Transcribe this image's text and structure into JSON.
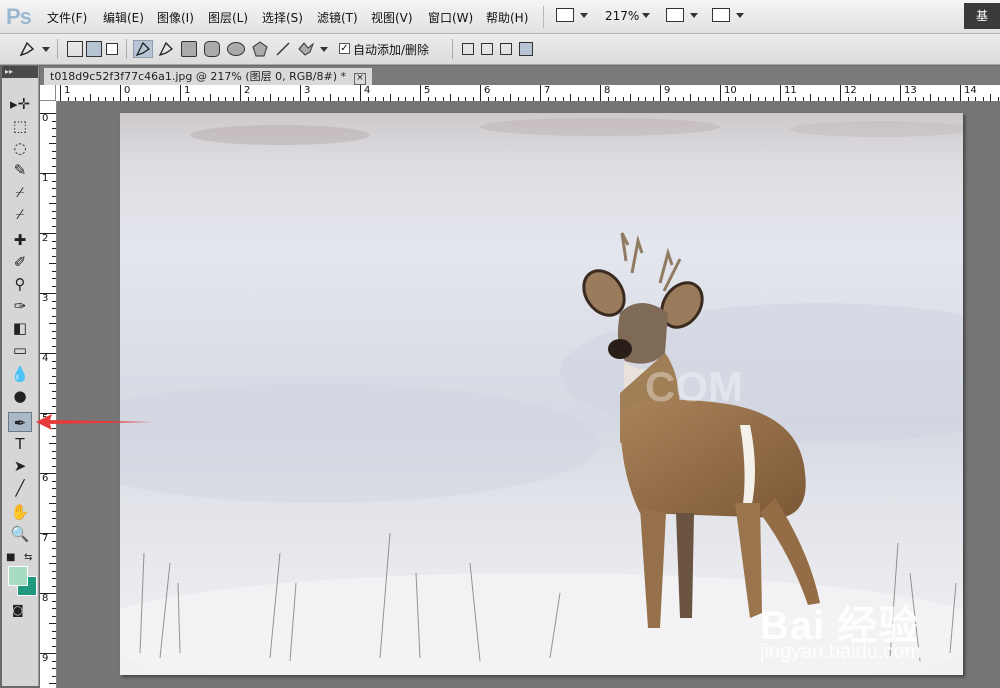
{
  "app": {
    "logo": "Ps"
  },
  "menu": [
    {
      "label": "文件(F)"
    },
    {
      "label": "编辑(E)"
    },
    {
      "label": "图像(I)"
    },
    {
      "label": "图层(L)"
    },
    {
      "label": "选择(S)"
    },
    {
      "label": "滤镜(T)"
    },
    {
      "label": "视图(V)"
    },
    {
      "label": "窗口(W)"
    },
    {
      "label": "帮助(H)"
    }
  ],
  "menubar": {
    "zoom": "217%",
    "workspace_label": "基"
  },
  "options": {
    "auto_add_delete_label": "自动添加/删除",
    "auto_add_delete_checked": true
  },
  "document": {
    "tab_title": "t018d9c52f3f77c46a1.jpg @ 217% (图层 0, RGB/8#) *",
    "close": "×"
  },
  "rulers": {
    "h": [
      "1",
      "0",
      "1",
      "2",
      "3",
      "4",
      "5",
      "6",
      "7",
      "8",
      "9",
      "10",
      "11",
      "12",
      "13",
      "14"
    ],
    "v": [
      "0",
      "1",
      "2",
      "3",
      "4",
      "5",
      "6",
      "7",
      "8",
      "9"
    ]
  },
  "tools": [
    {
      "name": "move-tool",
      "glyph": "▸✛"
    },
    {
      "name": "marquee-tool",
      "glyph": "⬚"
    },
    {
      "name": "lasso-tool",
      "glyph": "◌"
    },
    {
      "name": "quick-select-tool",
      "glyph": "✎"
    },
    {
      "name": "crop-tool",
      "glyph": "⌿"
    },
    {
      "name": "eyedropper-tool",
      "glyph": "⌿"
    },
    {
      "name": "healing-brush-tool",
      "glyph": "✚"
    },
    {
      "name": "brush-tool",
      "glyph": "✐"
    },
    {
      "name": "clone-stamp-tool",
      "glyph": "⚲"
    },
    {
      "name": "history-brush-tool",
      "glyph": "✑"
    },
    {
      "name": "eraser-tool",
      "glyph": "◧"
    },
    {
      "name": "gradient-tool",
      "glyph": "▭"
    },
    {
      "name": "blur-tool",
      "glyph": "💧"
    },
    {
      "name": "dodge-tool",
      "glyph": "●"
    },
    {
      "name": "pen-tool",
      "glyph": "✒",
      "active": true
    },
    {
      "name": "type-tool",
      "glyph": "T"
    },
    {
      "name": "path-select-tool",
      "glyph": "➤"
    },
    {
      "name": "line-tool",
      "glyph": "╱"
    },
    {
      "name": "hand-tool",
      "glyph": "✋"
    },
    {
      "name": "zoom-tool",
      "glyph": "🔍"
    }
  ],
  "swatches": {
    "foreground": "#a8dcc0",
    "background": "#1f9a7e"
  },
  "watermark": {
    "com": "COM",
    "brand": "Bai 经验",
    "url": "jingyan.baidu.com"
  },
  "colors": {
    "arrow": "#e83a3a",
    "active_tool": "#aab8c8"
  }
}
